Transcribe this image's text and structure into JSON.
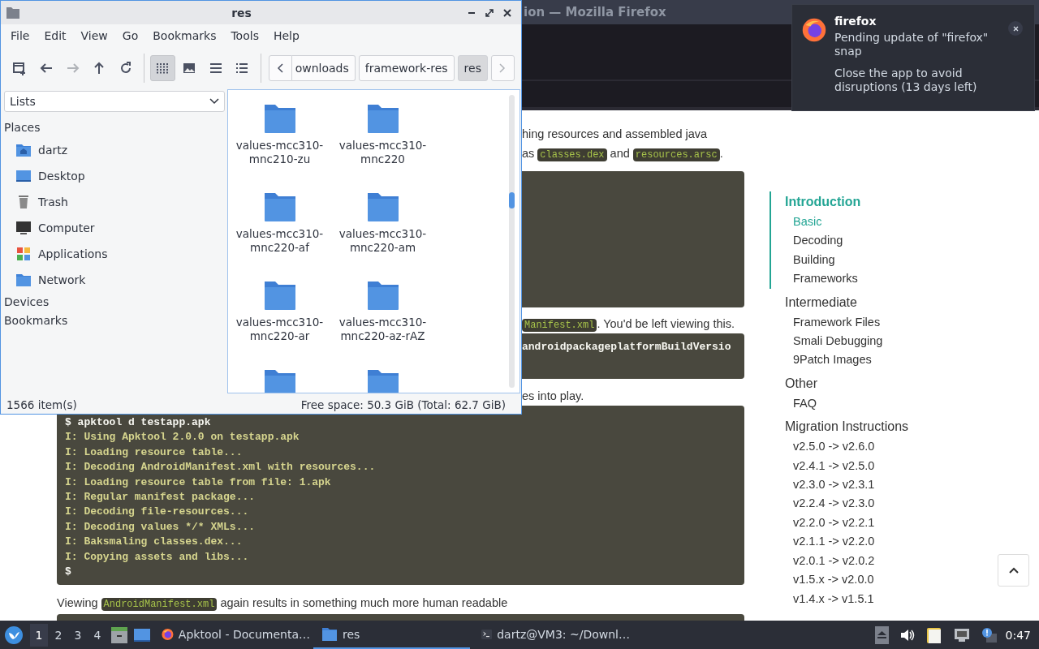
{
  "browser": {
    "title": "ion — Mozilla Firefox",
    "page": {
      "upper_blocks": [
        {
          "kind": "paragraph",
          "segments": [
            {
              "kind": "plain",
              "text": "hing resources and assembled java"
            }
          ]
        },
        {
          "kind": "paragraph",
          "segments": [
            {
              "kind": "plain",
              "text": "as "
            },
            {
              "kind": "code",
              "text": "classes.dex"
            },
            {
              "kind": "plain",
              "text": " and "
            },
            {
              "kind": "code",
              "text": "resources.arsc"
            },
            {
              "kind": "plain",
              "text": "."
            }
          ]
        },
        {
          "kind": "codeblock"
        },
        {
          "kind": "paragraph",
          "segments": [
            {
              "kind": "code",
              "text": "Manifest.xml"
            },
            {
              "kind": "plain",
              "text": ". You'd be left viewing this."
            }
          ]
        },
        {
          "kind": "codeblock",
          "lines": [
            {
              "kind": "command",
              "text": "androidpackageplatformBuildVersio"
            }
          ]
        },
        {
          "kind": "paragraph",
          "segments": [
            {
              "kind": "plain",
              "text": "es into play."
            }
          ]
        }
      ],
      "blocks": [
        {
          "kind": "codeblock",
          "lines": [
            {
              "kind": "command",
              "text": "$ apktool d testapp.apk"
            },
            {
              "kind": "output",
              "text": "I: Using Apktool 2.0.0 on testapp.apk"
            },
            {
              "kind": "output",
              "text": "I: Loading resource table..."
            },
            {
              "kind": "output",
              "text": "I: Decoding AndroidManifest.xml with resources..."
            },
            {
              "kind": "output",
              "text": "I: Loading resource table from file: 1.apk"
            },
            {
              "kind": "output",
              "text": "I: Regular manifest package..."
            },
            {
              "kind": "output",
              "text": "I: Decoding file-resources..."
            },
            {
              "kind": "output",
              "text": "I: Decoding values */* XMLs..."
            },
            {
              "kind": "output",
              "text": "I: Baksmaling classes.dex..."
            },
            {
              "kind": "output",
              "text": "I: Copying assets and libs..."
            },
            {
              "kind": "command",
              "text": "$"
            }
          ]
        },
        {
          "kind": "paragraph",
          "segments": [
            {
              "kind": "plain",
              "text": "Viewing "
            },
            {
              "kind": "code",
              "text": "AndroidManifest.xml"
            },
            {
              "kind": "plain",
              "text": " again results in something much more human readable"
            }
          ]
        },
        {
          "kind": "codeblock"
        }
      ],
      "toc": [
        {
          "title": "Introduction",
          "selected": true,
          "children": [
            {
              "label": "Basic",
              "selected": true
            },
            {
              "label": "Decoding",
              "selected": false
            },
            {
              "label": "Building",
              "selected": false
            },
            {
              "label": "Frameworks",
              "selected": false
            }
          ]
        },
        {
          "title": "Intermediate",
          "selected": false,
          "children": [
            {
              "label": "Framework Files",
              "selected": false
            },
            {
              "label": "Smali Debugging",
              "selected": false
            },
            {
              "label": "9Patch Images",
              "selected": false
            }
          ]
        },
        {
          "title": "Other",
          "selected": false,
          "children": [
            {
              "label": "FAQ",
              "selected": false
            }
          ]
        },
        {
          "title": "Migration Instructions",
          "selected": false,
          "children": [
            {
              "label": "v2.5.0 -> v2.6.0",
              "selected": false
            },
            {
              "label": "v2.4.1 -> v2.5.0",
              "selected": false
            },
            {
              "label": "v2.3.0 -> v2.3.1",
              "selected": false
            },
            {
              "label": "v2.2.4 -> v2.3.0",
              "selected": false
            },
            {
              "label": "v2.2.0 -> v2.2.1",
              "selected": false
            },
            {
              "label": "v2.1.1 -> v2.2.0",
              "selected": false
            },
            {
              "label": "v2.0.1 -> v2.0.2",
              "selected": false
            },
            {
              "label": "v1.5.x -> v2.0.0",
              "selected": false
            },
            {
              "label": "v1.4.x -> v1.5.1",
              "selected": false
            }
          ]
        }
      ]
    }
  },
  "file_manager": {
    "title": "res",
    "menu": [
      "File",
      "Edit",
      "View",
      "Go",
      "Bookmarks",
      "Tools",
      "Help"
    ],
    "toolbar": [
      {
        "kind": "newwindow",
        "disabled": false
      },
      {
        "kind": "back",
        "disabled": false
      },
      {
        "kind": "forward",
        "disabled": true
      },
      {
        "kind": "up",
        "disabled": false
      },
      {
        "kind": "reload",
        "disabled": false
      }
    ],
    "views": [
      {
        "kind": "icons",
        "selected": true
      },
      {
        "kind": "thumbnails",
        "selected": false
      },
      {
        "kind": "compact",
        "selected": false
      },
      {
        "kind": "details",
        "selected": false
      }
    ],
    "breadcrumb": {
      "scroll_back_disabled": false,
      "scroll_forward_disabled": true,
      "items": [
        {
          "label": "ownloads",
          "selected": false
        },
        {
          "label": "framework-res",
          "selected": false
        },
        {
          "label": "res",
          "selected": true
        }
      ]
    },
    "side_pane": {
      "mode": "Lists",
      "places_heading": "Places",
      "places": [
        {
          "kind": "home",
          "label": "dartz"
        },
        {
          "kind": "desktop",
          "label": "Desktop"
        },
        {
          "kind": "trash",
          "label": "Trash"
        },
        {
          "kind": "computer",
          "label": "Computer"
        },
        {
          "kind": "apps",
          "label": "Applications"
        },
        {
          "kind": "network",
          "label": "Network"
        }
      ],
      "devices_heading": "Devices",
      "bookmarks_heading": "Bookmarks"
    },
    "items": [
      {
        "kind": "folder",
        "name": "values-mcc310-mnc210-zu"
      },
      {
        "kind": "folder",
        "name": "values-mcc310-mnc220"
      },
      {
        "kind": "folder",
        "name": "values-mcc310-mnc220-af"
      },
      {
        "kind": "folder",
        "name": "values-mcc310-mnc220-am"
      },
      {
        "kind": "folder",
        "name": "values-mcc310-mnc220-ar"
      },
      {
        "kind": "folder",
        "name": "values-mcc310-mnc220-az-rAZ"
      },
      {
        "kind": "folder"
      },
      {
        "kind": "folder"
      }
    ],
    "status": {
      "count": "1566 item(s)",
      "free_space": "Free space: 50.3 GiB (Total: 62.7 GiB)"
    }
  },
  "notification": {
    "app": "firefox",
    "summary": "Pending update of \"firefox\" snap",
    "body": "Close the app to avoid disruptions (13 days left)"
  },
  "taskbar": {
    "workspaces": [
      {
        "label": "1",
        "selected": true
      },
      {
        "label": "2",
        "selected": false
      },
      {
        "label": "3",
        "selected": false
      },
      {
        "label": "4",
        "selected": false
      }
    ],
    "launchers": [
      {
        "kind": "files"
      },
      {
        "kind": "desktop"
      }
    ],
    "tasks": [
      {
        "kind": "browser",
        "label": "Apktool - Documenta…",
        "selected": false
      },
      {
        "kind": "folder",
        "label": "res",
        "selected": true
      },
      {
        "kind": "terminal",
        "label": "dartz@VM3: ~/Downl…",
        "selected": false
      }
    ],
    "tray": [
      {
        "kind": "eject"
      },
      {
        "kind": "volume"
      },
      {
        "kind": "clipboard"
      },
      {
        "kind": "network"
      },
      {
        "kind": "alert"
      }
    ],
    "clock": "0:47"
  }
}
